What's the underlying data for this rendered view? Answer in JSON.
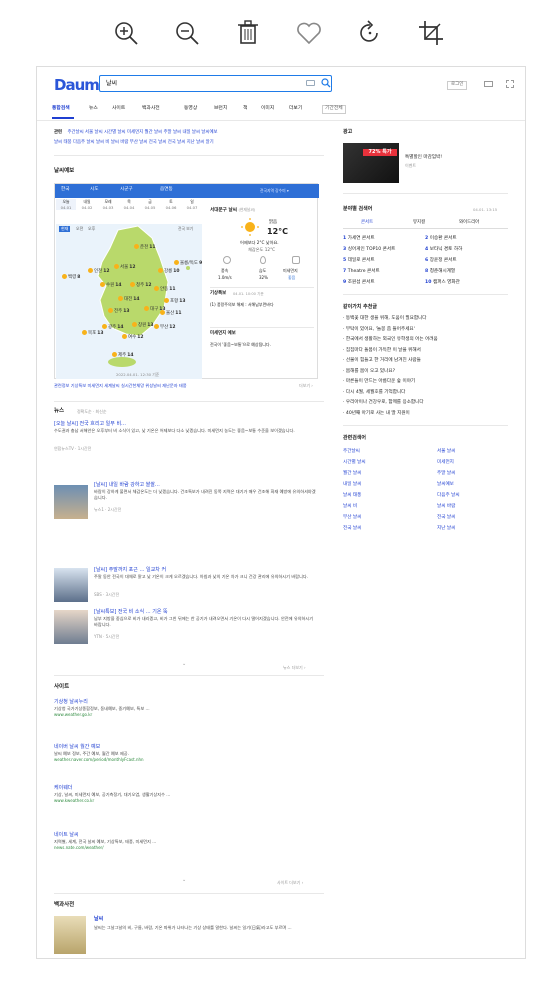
{
  "toolbar": {
    "icons": [
      "zoom-in-icon",
      "zoom-out-icon",
      "trash-icon",
      "heart-icon",
      "rotate-icon",
      "crop-icon"
    ]
  },
  "header": {
    "logo": "Daum",
    "query": "날씨",
    "login": "로그인"
  },
  "tabs": [
    "통합검색",
    "뉴스",
    "사이트",
    "백과사전",
    "동영상",
    "브런치",
    "책",
    "이미지",
    "더보기",
    "기간전체"
  ],
  "related": {
    "label": "관련",
    "row1": "주간날씨   서울 날씨   시간별 날씨   미세먼지   월간 날씨   주말 날씨   내일 날씨   날씨예보",
    "row2": "날씨 태풍   다음주 날씨   날씨 비   날씨 바람   부산 날씨   전국 날씨   전국 날씨   지난 날씨   알기"
  },
  "weather": {
    "section": "날씨예보",
    "region_tabs": [
      "한국",
      "시도",
      "시군구",
      "읍면동"
    ],
    "bar_right": "전국지역 강수미 ▾",
    "days": [
      "오늘",
      "내일",
      "모레",
      "목",
      "금",
      "토",
      "일"
    ],
    "dates": [
      "04.01",
      "04.02",
      "04.03",
      "04.04",
      "04.05",
      "04.06",
      "04.07"
    ],
    "map_tabs": [
      "현재",
      "오전",
      "오후"
    ],
    "map_note": "전국 보기",
    "cities": [
      {
        "name": "춘천",
        "temp": "11"
      },
      {
        "name": "강릉",
        "temp": "10"
      },
      {
        "name": "서울",
        "temp": "12"
      },
      {
        "name": "인천",
        "temp": "12"
      },
      {
        "name": "수원",
        "temp": "14"
      },
      {
        "name": "청주",
        "temp": "12"
      },
      {
        "name": "백령",
        "temp": "8"
      },
      {
        "name": "안동",
        "temp": "11"
      },
      {
        "name": "대전",
        "temp": "14"
      },
      {
        "name": "전주",
        "temp": "13"
      },
      {
        "name": "대구",
        "temp": "13"
      },
      {
        "name": "울산",
        "temp": "11"
      },
      {
        "name": "광주",
        "temp": "14"
      },
      {
        "name": "부산",
        "temp": "12"
      },
      {
        "name": "목포",
        "temp": "13"
      },
      {
        "name": "여수",
        "temp": "12"
      },
      {
        "name": "제주",
        "temp": "14"
      },
      {
        "name": "울릉/독도",
        "temp": "9"
      },
      {
        "name": "포항",
        "temp": "13"
      },
      {
        "name": "창원",
        "temp": "13"
      }
    ],
    "timestamp": "2022.04.01. 12:30 기준",
    "current": {
      "location": "서대문구 날씨",
      "updated": "(현재날씨)",
      "cond": "맑음",
      "temp": "12°C",
      "desc1": "어제보다 2°C 낮아요.",
      "desc2": "체감온도 12°C",
      "labels": [
        "풍속",
        "습도",
        "미세먼지"
      ],
      "values": [
        "1.0m/s",
        "32%",
        "좋음"
      ],
      "alert_title": "기상특보",
      "alert_time": "04.01. 10:00 기준",
      "alert_text": "(1) 풍랑주의보 해제 : 서해남부먼바다",
      "dust_title": "미세먼지 예보",
      "dust_text": "전국이 '좋음~보통'으로 예상됩니다."
    },
    "footer": "관련정보  기상특보  미세먼지  세계날씨  실시간천체망  위성날씨  재난문자  태풍",
    "more": "더보기 ›"
  },
  "news": {
    "section": "뉴스",
    "sort": "정확도순 · 최신순",
    "items": [
      {
        "title": "[오늘 날씨] 전국 흐리고 일부 비…",
        "body": "수도권과 충남 서해안은 오후부터 비 소식이 있고, 낮 기온은 어제보다 다소 낮겠습니다. 미세먼지 농도는 좋음~보통 수준을 보이겠습니다.",
        "src": "연합뉴스TV · 1시간전"
      },
      {
        "title": "[날씨] 내일 바람 강하고 쌀쌀…",
        "body": "바람이 강하게 불면서 체감온도는 더 낮겠습니다. 건조특보가 내려진 동쪽 지역은 대기가 매우 건조해 화재 예방에 유의하셔야겠습니다.",
        "src": "뉴스1 · 2시간전"
      },
      {
        "title": "[날씨] 주말까지 포근 … 일교차 커",
        "body": "주말 동안 전국이 대체로 맑고 낮 기온이 크게 오르겠습니다. 아침과 낮의 기온 차가 크니 건강 관리에 유의하시기 바랍니다.",
        "src": "SBS · 3시간전"
      },
      {
        "title": "[날씨특보] 전국 비 소식 … 기온 뚝",
        "body": "남부 지방을 중심으로 비가 내리겠고, 비가 그친 뒤에는 찬 공기가 내려오면서 기온이 다시 떨어지겠습니다. 안전에 유의하시기 바랍니다.",
        "src": "YTN · 5시간전"
      }
    ],
    "more": "뉴스 더보기 ›"
  },
  "sites": {
    "section": "사이트",
    "items": [
      {
        "title": "기상청 날씨누리",
        "desc": "기상청 국가기상종합정보, 동네예보, 중기예보, 특보 ...",
        "url": "www.weather.go.kr"
      },
      {
        "title": "네이버 날씨 월간 예보",
        "desc": "날씨 예보 정보, 주간 예보, 월간 예보 제공.",
        "url": "weather.naver.com/period/monthlyFcast.nhn"
      },
      {
        "title": "케이웨더",
        "desc": "기상, 날씨, 미세먼지 예보, 공기측정기, 대기오염, 생활기상지수 ...",
        "url": "www.kweather.co.kr"
      },
      {
        "title": "네이트 날씨",
        "desc": "지역별, 세계, 전국 날씨 예보, 기상특보, 태풍, 미세먼지 ...",
        "url": "news.nate.com/weather/"
      }
    ],
    "more": "사이트 더보기 ›"
  },
  "encyclopedia": {
    "section": "백과사전",
    "title": "날씨",
    "body": "날씨는 그날그날의 비, 구름, 바람, 기온 따위가 나타나는 기상 상태를 말한다. 날씨는 일기(日氣)라고도 부르며 ..."
  },
  "sidebar": {
    "ad_label": "광고",
    "ad_title": "특별할인 마감임박!",
    "ad_sub": "이벤트",
    "ad_banner": "72% 특가",
    "rank_title": "분야별 검색어",
    "rank_time": "04.01. 13:15",
    "rank_tabs": [
      "콘서트",
      "뮤지컬",
      "와이드리아"
    ],
    "ranks": [
      "가세연 콘서트",
      "이승환 콘서트",
      "싱어게인 TOP10 콘서트",
      "보타닉 경토 하하",
      "데일로 콘서트",
      "장윤정 콘서트",
      "Theatre 콘서트",
      "청춘해시계열",
      "조원섭 콘서트",
      "캠퍼스 영화관"
    ],
    "story_title": "같이가치 추천글",
    "stories": [
      "동백꽃 대한 생을 위해, 도움이 필요합니다",
      "부탁이 있어요, '놀봉 쫌 뜰어주세요'",
      "한국에서 생활하는 외국인 유학생의 어는 어려움",
      "집집마다 돌봄이 가득한 이 날을 위해서",
      "선물이 힘들고 한 거리에 남겨진 사람들",
      "봄해를 봄이 오고 있나요?",
      "마른들이 만드는 아름다운 숲 이야기",
      "다시 4월, 세월호를 기억합니다",
      "우리아이나 건강우로, 함께를 응소합니다",
      "40년째 아기로 사는 내 딸 지원이"
    ],
    "rel_title": "관련검색어",
    "rel": [
      "주간날씨",
      "서울 날씨",
      "시간별 날씨",
      "미세먼지",
      "월간 날씨",
      "주말 날씨",
      "내일 날씨",
      "날씨예보",
      "날씨 태풍",
      "다음주 날씨",
      "날씨 비",
      "날씨 바람",
      "부산 날씨",
      "전국 날씨",
      "전국 날씨",
      "지난 날씨"
    ]
  }
}
